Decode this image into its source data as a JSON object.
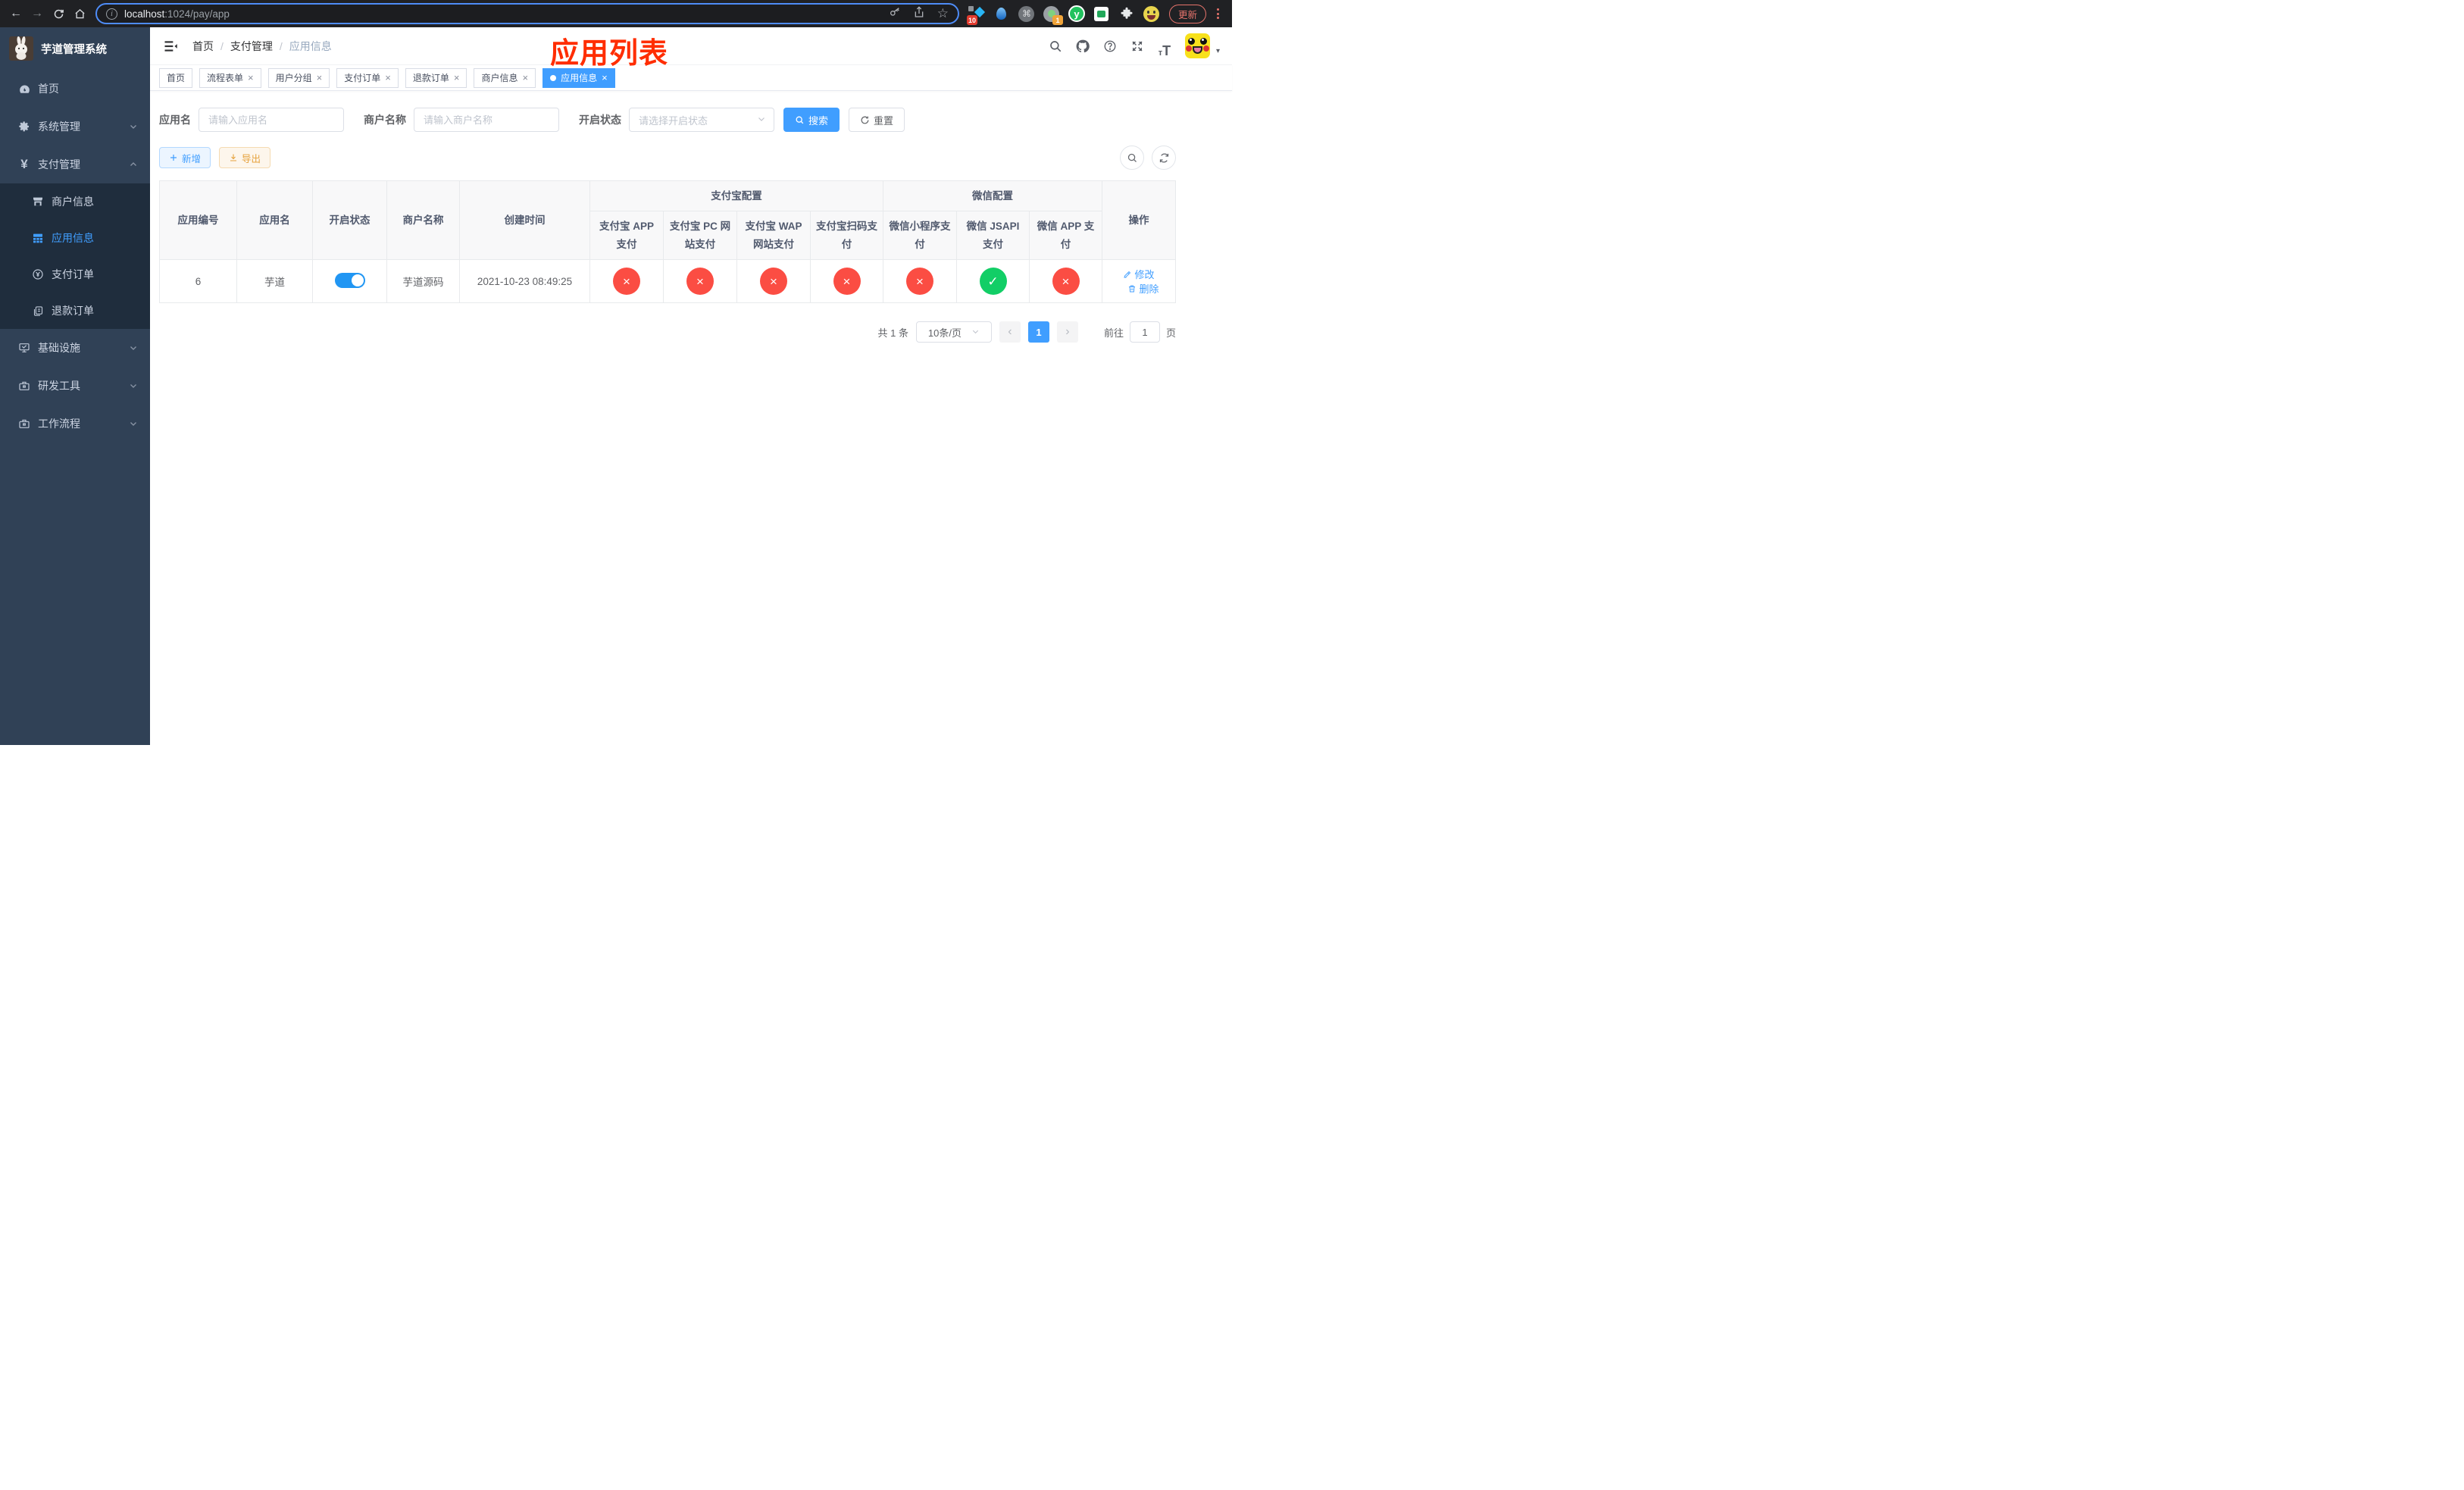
{
  "browser": {
    "url": {
      "host": "localhost",
      "path": ":1024/pay/app"
    },
    "update_label": "更新",
    "ext_badge_10": "10",
    "ext_badge_1": "1",
    "ext_letter_y": "y"
  },
  "glyphs": {
    "back": "←",
    "forward": "→",
    "star": "☆",
    "command": "⌘",
    "info": "i",
    "caret_down": "▾",
    "prev": "‹",
    "next": "›"
  },
  "sidebar": {
    "title": "芋道管理系统",
    "menu": [
      {
        "label": "首页"
      },
      {
        "label": "系统管理"
      },
      {
        "label": "支付管理"
      },
      {
        "label": "商户信息"
      },
      {
        "label": "应用信息"
      },
      {
        "label": "支付订单"
      },
      {
        "label": "退款订单"
      },
      {
        "label": "基础设施"
      },
      {
        "label": "研发工具"
      },
      {
        "label": "工作流程"
      }
    ],
    "yen_glyph": "¥"
  },
  "navbar": {
    "breadcrumb": {
      "home": "首页",
      "sep": "/",
      "section": "支付管理",
      "current": "应用信息"
    },
    "annotation": "应用列表"
  },
  "tags": [
    {
      "label": "首页"
    },
    {
      "label": "流程表单",
      "close": "×"
    },
    {
      "label": "用户分组",
      "close": "×"
    },
    {
      "label": "支付订单",
      "close": "×"
    },
    {
      "label": "退款订单",
      "close": "×"
    },
    {
      "label": "商户信息",
      "close": "×"
    },
    {
      "label": "应用信息",
      "close": "×"
    }
  ],
  "filters": {
    "app_name": {
      "label": "应用名",
      "placeholder": "请输入应用名",
      "value": ""
    },
    "merchant_name": {
      "label": "商户名称",
      "placeholder": "请输入商户名称",
      "value": ""
    },
    "status": {
      "label": "开启状态",
      "placeholder": "请选择开启状态"
    },
    "search_label": "搜索",
    "reset_label": "重置"
  },
  "toolbar": {
    "add_label": "新增",
    "export_label": "导出"
  },
  "table": {
    "cols": [
      "应用编号",
      "应用名",
      "开启状态",
      "商户名称",
      "创建时间"
    ],
    "groups": [
      "支付宝配置",
      "微信配置"
    ],
    "subcols": [
      "支付宝 APP 支付",
      "支付宝 PC 网站支付",
      "支付宝 WAP 网站支付",
      "支付宝扫码支付",
      "微信小程序支付",
      "微信 JSAPI 支付",
      "微信 APP 支付"
    ],
    "op_col": "操作",
    "row": {
      "id": "6",
      "name": "芋道",
      "enabled": true,
      "merchant": "芋道源码",
      "created": "2021-10-23 08:49:25",
      "channels": [
        {
          "name": "alipay-app",
          "enabled": false,
          "cls": "status-circle red",
          "glyph": "×"
        },
        {
          "name": "alipay-pc",
          "enabled": false,
          "cls": "status-circle red",
          "glyph": "×"
        },
        {
          "name": "alipay-wap",
          "enabled": false,
          "cls": "status-circle red",
          "glyph": "×"
        },
        {
          "name": "alipay-qr",
          "enabled": false,
          "cls": "status-circle red",
          "glyph": "×"
        },
        {
          "name": "wx-miniprogram",
          "enabled": false,
          "cls": "status-circle red",
          "glyph": "×"
        },
        {
          "name": "wx-jsapi",
          "enabled": true,
          "cls": "status-circle green",
          "glyph": "✓"
        },
        {
          "name": "wx-app",
          "enabled": false,
          "cls": "status-circle red",
          "glyph": "×"
        }
      ],
      "edit_label": "修改",
      "delete_label": "删除"
    }
  },
  "pagination": {
    "total_text": "共 1 条",
    "page_size": "10条/页",
    "page": "1",
    "goto_label": "前往",
    "goto_value": "1",
    "page_unit": "页"
  },
  "colors": {
    "primary": "#409eff",
    "success": "#12ce66",
    "danger": "#fb4d43",
    "warning": "#e6a23c",
    "annotation": "#ff2d00",
    "sidebar_bg": "#304156",
    "submenu_bg": "#1f2d3d",
    "table_header_bg": "#f8f8f9"
  }
}
